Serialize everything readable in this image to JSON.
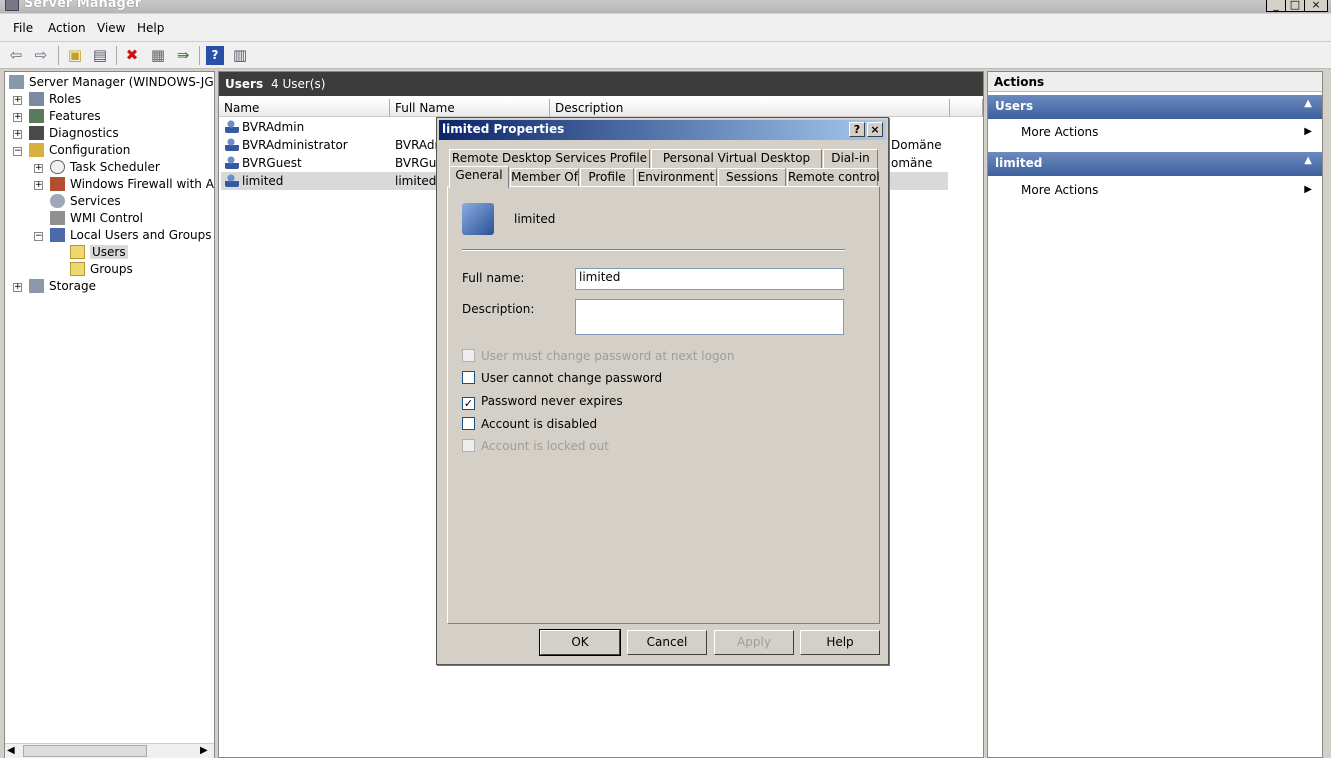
{
  "window": {
    "title": "Server Manager",
    "controls": [
      "_",
      "□",
      "×"
    ]
  },
  "menu": [
    "File",
    "Action",
    "View",
    "Help"
  ],
  "toolbar_icons": [
    "back-arrow-icon",
    "forward-arrow-icon",
    "up-folder-icon",
    "show-hide-tree-icon",
    "delete-icon",
    "properties-icon",
    "export-icon",
    "help-icon",
    "show-hide-actions-icon"
  ],
  "tree": {
    "root": "Server Manager (WINDOWS-JGHJC",
    "items": [
      {
        "label": "Roles",
        "exp": "+"
      },
      {
        "label": "Features",
        "exp": "+"
      },
      {
        "label": "Diagnostics",
        "exp": "+"
      },
      {
        "label": "Configuration",
        "exp": "−"
      },
      {
        "label": "Task Scheduler",
        "exp": "+"
      },
      {
        "label": "Windows Firewall with Adva",
        "exp": "+"
      },
      {
        "label": "Services"
      },
      {
        "label": "WMI Control"
      },
      {
        "label": "Local Users and Groups",
        "exp": "−"
      },
      {
        "label": "Users",
        "selected": true
      },
      {
        "label": "Groups"
      },
      {
        "label": "Storage",
        "exp": "+"
      }
    ]
  },
  "center": {
    "title": "Users",
    "count": "4 User(s)",
    "columns": [
      "Name",
      "Full Name",
      "Description"
    ],
    "rows": [
      {
        "name": "BVRAdmin",
        "full": "",
        "desc": ""
      },
      {
        "name": "BVRAdministrator",
        "full": "BVRAdm",
        "desc": "Domäne"
      },
      {
        "name": "BVRGuest",
        "full": "BVRGue",
        "desc": "omäne"
      },
      {
        "name": "limited",
        "full": "limited",
        "desc": "",
        "selected": true
      }
    ]
  },
  "actions": {
    "header": "Actions",
    "sections": [
      {
        "title": "Users",
        "items": [
          "More Actions"
        ]
      },
      {
        "title": "limited",
        "items": [
          "More Actions"
        ]
      }
    ]
  },
  "dialog": {
    "title": "limited Properties",
    "help_btn": "?",
    "close_btn": "×",
    "tabs_row1": [
      "Remote Desktop Services Profile",
      "Personal Virtual Desktop",
      "Dial-in"
    ],
    "tabs_row2": [
      "General",
      "Member Of",
      "Profile",
      "Environment",
      "Sessions",
      "Remote control"
    ],
    "active_tab": "General",
    "username": "limited",
    "full_name_label": "Full name:",
    "full_name_value": "limited",
    "description_label": "Description:",
    "description_value": "",
    "checkboxes": [
      {
        "label": "User must change password at next logon",
        "checked": false,
        "disabled": true
      },
      {
        "label": "User cannot change password",
        "checked": false,
        "disabled": false
      },
      {
        "label": "Password never expires",
        "checked": true,
        "disabled": false
      },
      {
        "label": "Account is disabled",
        "checked": false,
        "disabled": false
      },
      {
        "label": "Account is locked out",
        "checked": false,
        "disabled": true
      }
    ],
    "buttons": {
      "ok": "OK",
      "cancel": "Cancel",
      "apply": "Apply",
      "help": "Help"
    }
  }
}
